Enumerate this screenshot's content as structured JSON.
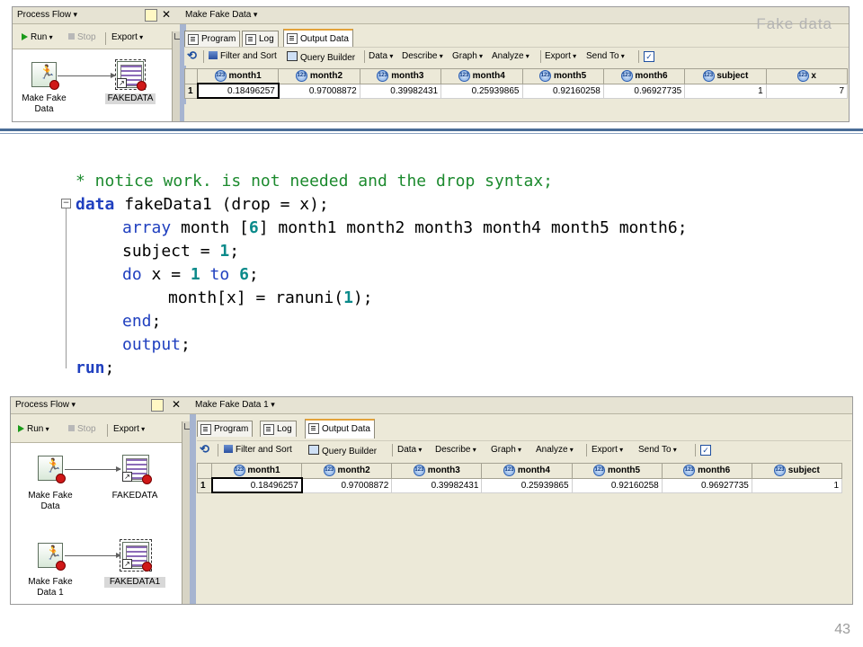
{
  "slide": {
    "title": "Fake data",
    "page_number": "43"
  },
  "top_screenshot": {
    "process_flow": {
      "title": "Process Flow",
      "toolbar": {
        "run": "Run",
        "stop": "Stop",
        "export": "Export"
      },
      "nodes": [
        {
          "label_line1": "Make Fake",
          "label_line2": "Data"
        },
        {
          "label": "FAKEDATA"
        }
      ]
    },
    "editor": {
      "title": "Make Fake Data",
      "tabs": [
        "Program",
        "Log",
        "Output Data"
      ],
      "toolbar": [
        "Filter and Sort",
        "Query Builder",
        "Data",
        "Describe",
        "Graph",
        "Analyze",
        "Export",
        "Send To"
      ],
      "columns": [
        "month1",
        "month2",
        "month3",
        "month4",
        "month5",
        "month6",
        "subject",
        "x"
      ],
      "rows": [
        {
          "row_num": "1",
          "cells": [
            "0.18496257",
            "0.97008872",
            "0.39982431",
            "0.25939865",
            "0.92160258",
            "0.96927735",
            "1",
            "7"
          ]
        }
      ]
    }
  },
  "code": {
    "line1": "* notice work. is not needed and the drop syntax;",
    "line2_kw": "data",
    "line2_rest": " fakeData1 (drop = x);",
    "line3_kw": "array",
    "line3_a": " month [",
    "line3_num": "6",
    "line3_b": "] month1 month2 month3 month4 month5 month6;",
    "line4_a": "subject = ",
    "line4_num": "1",
    "line4_b": ";",
    "line5_kw1": "do",
    "line5_a": " x = ",
    "line5_num1": "1",
    "line5_kw2": " to ",
    "line5_num2": "6",
    "line5_b": ";",
    "line6_a": "month[x] = ranuni(",
    "line6_num": "1",
    "line6_b": ");",
    "line7_kw": "end",
    "line7_b": ";",
    "line8_kw": "output",
    "line8_b": ";",
    "line9_kw": "run",
    "line9_b": ";"
  },
  "bottom_screenshot": {
    "process_flow": {
      "title": "Process Flow",
      "toolbar": {
        "run": "Run",
        "stop": "Stop",
        "export": "Export"
      },
      "nodes": [
        {
          "label_line1": "Make Fake",
          "label_line2": "Data"
        },
        {
          "label": "FAKEDATA"
        },
        {
          "label_line1": "Make Fake",
          "label_line2": "Data 1"
        },
        {
          "label": "FAKEDATA1"
        }
      ]
    },
    "editor": {
      "title": "Make Fake Data 1",
      "tabs": [
        "Program",
        "Log",
        "Output Data"
      ],
      "toolbar": [
        "Filter and Sort",
        "Query Builder",
        "Data",
        "Describe",
        "Graph",
        "Analyze",
        "Export",
        "Send To"
      ],
      "columns": [
        "month1",
        "month2",
        "month3",
        "month4",
        "month5",
        "month6",
        "subject"
      ],
      "rows": [
        {
          "row_num": "1",
          "cells": [
            "0.18496257",
            "0.97008872",
            "0.39982431",
            "0.25939865",
            "0.92160258",
            "0.96927735",
            "1"
          ]
        }
      ]
    }
  },
  "colors": {
    "keyword": "#1f3fbf",
    "comment": "#1c8a2e",
    "number": "#0a8a8a",
    "rule": "#4a6d97",
    "panel_bg": "#ece9d8"
  },
  "icons": [
    "play-icon",
    "stop-icon",
    "pin-icon",
    "close-icon",
    "runner-icon",
    "dataset-icon",
    "program-icon",
    "log-icon",
    "output-data-icon",
    "refresh-icon",
    "filter-icon",
    "query-builder-icon",
    "checkbox-icon",
    "numeric-column-icon",
    "fold-icon"
  ]
}
